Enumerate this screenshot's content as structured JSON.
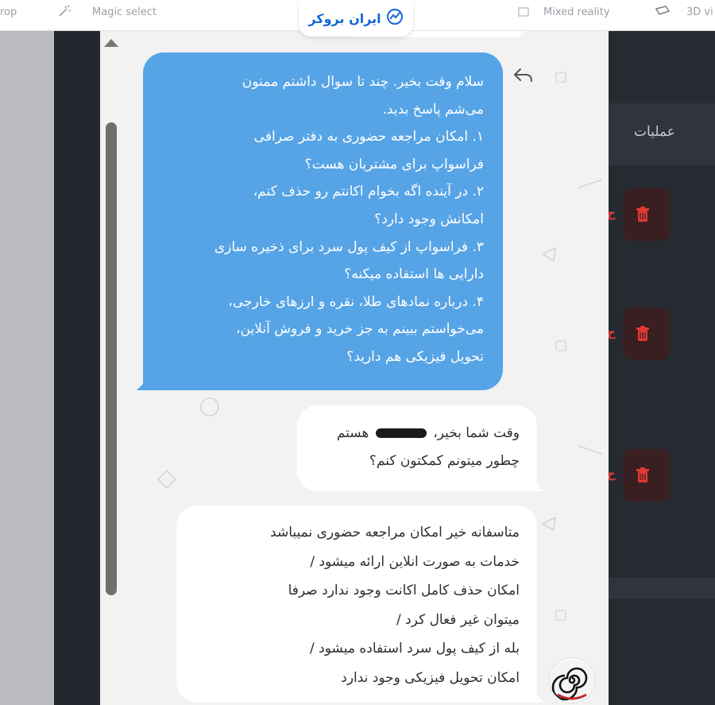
{
  "browser_bar": {
    "left_fragment": "rop",
    "magic_select": "Magic select",
    "mixed_reality": "Mixed reality",
    "view_3d": "3D vi"
  },
  "brand": {
    "name": "ایران بروکر",
    "color": "#1566d4"
  },
  "right_panel": {
    "column_header": "عملیات",
    "delete_fragment": "ح",
    "delete_color": "#e53935"
  },
  "chat": {
    "outgoing": {
      "lines": [
        "سلام وقت بخیر. چند تا سوال داشتم ممنون",
        "می‌شم پاسخ بدید.",
        "۱. امکان مراجعه حضوری به دفتر صرافی",
        "فراسواپ برای مشتریان هست؟",
        "۲. در آینده اگه بخوام اکانتم رو حذف کنم،",
        "امکانش وجود دارد؟",
        "۳. فراسواپ از کیف پول سرد برای ذخیره سازی",
        "دارایی ها استفاده میکنه؟",
        "۴. درباره نمادهای طلا، نقره و ارزهای خارجی،",
        "می‌خواستم ببینم به جز خرید و فروش آنلاین،",
        "تحویل فیزیکی هم دارید؟"
      ],
      "color": "#56a4e6"
    },
    "incoming": [
      {
        "line1_start": "وقت شما بخیر،",
        "line1_end": "هستم",
        "line2": "چطور میتونم کمکتون کنم؟"
      },
      {
        "lines": [
          "متاسفانه خیر امکان مراجعه حضوری نمیباشد",
          "خدمات به صورت انلاین ارائه میشود /",
          "امکان حذف کامل اکانت وجود ندارد صرفا",
          "میتوان غیر فعال کرد /",
          "بله از کیف پول سرد استفاده میشود /",
          "امکان تحویل فیزیکی وجود ندارد"
        ]
      }
    ]
  },
  "icons": {
    "reply": "reply-arrow-icon",
    "trash": "trash-icon",
    "brand_logo": "brand-chart-icon",
    "avatar": "spiral-avatar"
  }
}
